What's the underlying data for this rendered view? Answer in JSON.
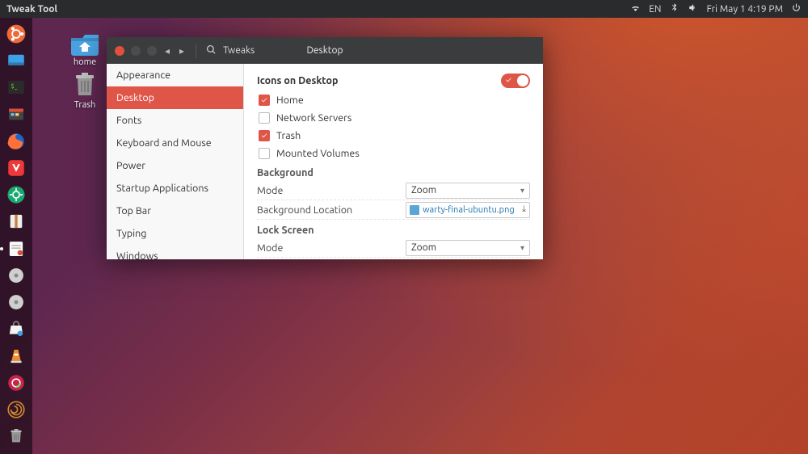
{
  "topbar": {
    "app_title": "Tweak Tool",
    "lang": "EN",
    "clock": "Fri May 1  4:19 PM"
  },
  "desktop": {
    "home_label": "home",
    "trash_label": "Trash"
  },
  "window": {
    "app_name": "Tweaks",
    "header_title": "Desktop",
    "sidebar": [
      "Appearance",
      "Desktop",
      "Fonts",
      "Keyboard and Mouse",
      "Power",
      "Startup Applications",
      "Top Bar",
      "Typing",
      "Windows"
    ],
    "sidebar_active_index": 1,
    "content": {
      "section_icons_title": "Icons on Desktop",
      "icons_toggle_on": true,
      "checks": [
        {
          "label": "Home",
          "on": true
        },
        {
          "label": "Network Servers",
          "on": false
        },
        {
          "label": "Trash",
          "on": true
        },
        {
          "label": "Mounted Volumes",
          "on": false
        }
      ],
      "background_head": "Background",
      "bg_mode_label": "Mode",
      "bg_mode_value": "Zoom",
      "bg_loc_label": "Background Location",
      "bg_loc_value": "warty-final-ubuntu.png",
      "lock_head": "Lock Screen",
      "lock_mode_label": "Mode",
      "lock_mode_value": "Zoom"
    }
  }
}
